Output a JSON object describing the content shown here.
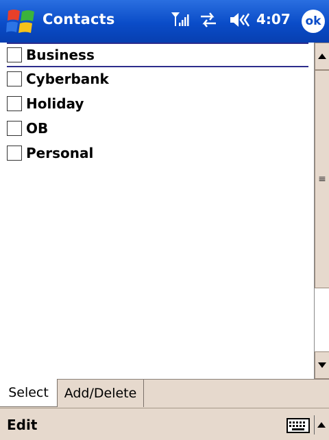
{
  "titlebar": {
    "title": "Contacts",
    "time": "4:07",
    "ok_label": "ok",
    "icons": [
      "windows-start-icon",
      "signal-icon",
      "connectivity-icon",
      "volume-icon"
    ]
  },
  "categories": [
    {
      "label": "Business",
      "checked": false,
      "selected": true
    },
    {
      "label": "Cyberbank",
      "checked": false,
      "selected": false
    },
    {
      "label": "Holiday",
      "checked": false,
      "selected": false
    },
    {
      "label": "OB",
      "checked": false,
      "selected": false
    },
    {
      "label": "Personal",
      "checked": false,
      "selected": false
    }
  ],
  "tabs": [
    {
      "label": "Select",
      "active": true
    },
    {
      "label": "Add/Delete",
      "active": false
    }
  ],
  "menubar": {
    "edit_label": "Edit",
    "icons": [
      "keyboard-icon",
      "sip-up-arrow-icon"
    ]
  },
  "colors": {
    "title_bar": "#0a4cc8",
    "chrome": "#e6d9cd",
    "selection_border": "#2c2c8c"
  }
}
